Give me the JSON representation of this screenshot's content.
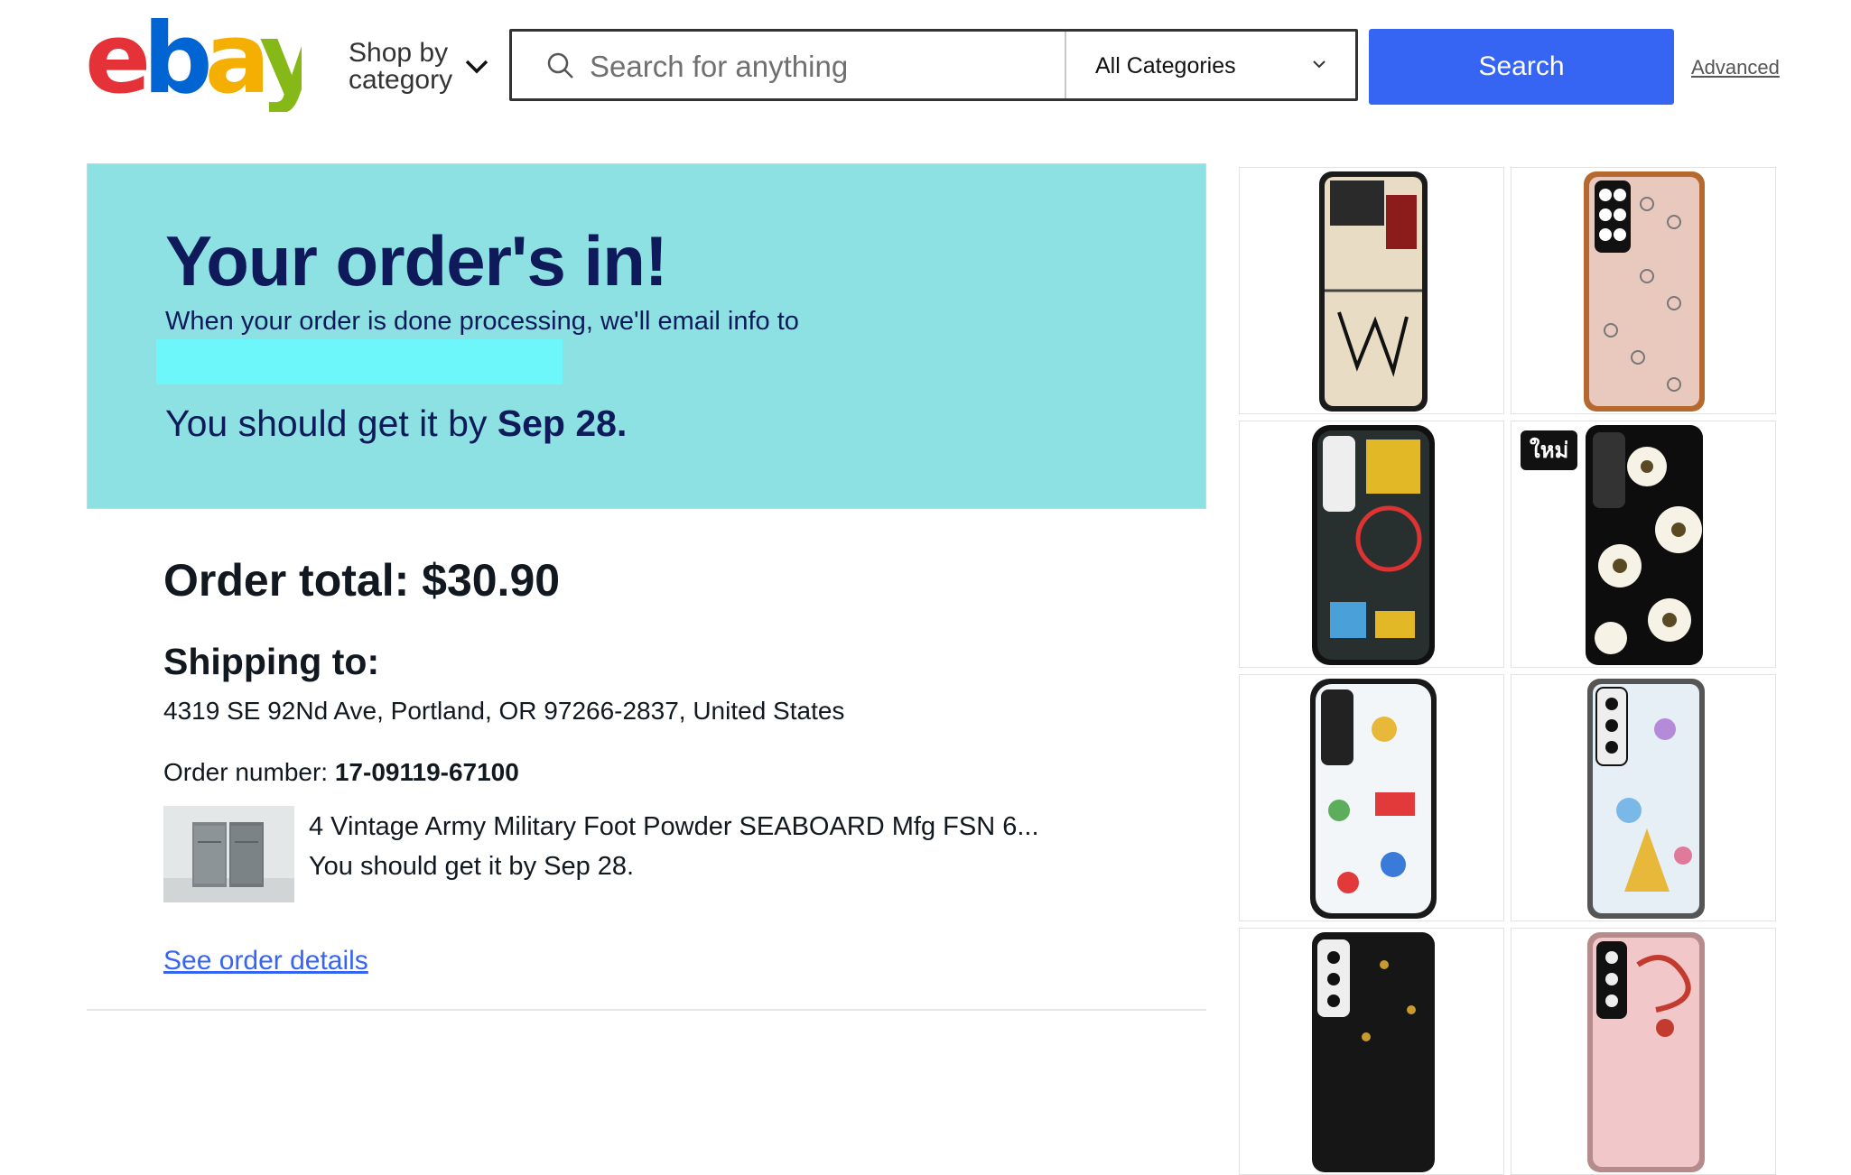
{
  "header": {
    "logo_text": "ebay",
    "logo_colors": [
      "#e53238",
      "#0064d2",
      "#f5af02",
      "#86b817"
    ],
    "shop_by_category_line1": "Shop by",
    "shop_by_category_line2": "category",
    "search_placeholder": "Search for anything",
    "category_select": "All Categories",
    "search_button": "Search",
    "advanced_link": "Advanced"
  },
  "banner": {
    "title": "Your order's in!",
    "email_note": "When your order is done processing, we'll email info to",
    "eta_prefix": "You should get it by ",
    "eta_date": "Sep 28."
  },
  "order": {
    "total_label": "Order total: $30.90",
    "shipping_heading": "Shipping to:",
    "address": "4319 SE 92Nd Ave, Portland, OR 97266-2837, United States",
    "order_number_label": "Order number: ",
    "order_number": "17-09119-67100",
    "item_title": "4 Vintage Army Military Foot Powder SEABOARD Mfg FSN 6...",
    "item_eta": "You should get it by Sep 28.",
    "details_link": "See order details"
  },
  "ads": {
    "new_badge": "ใหม่",
    "items": [
      {
        "name": "basquiat-flip-case",
        "case_color": "#e9dcc4",
        "accent": "#8c1c1c"
      },
      {
        "name": "smiley-pattern-case",
        "case_color": "#e9c9bd",
        "accent": "#b5692f"
      },
      {
        "name": "basquiat-liberty-case",
        "case_color": "#27302f",
        "accent": "#e2b826"
      },
      {
        "name": "daisy-black-case",
        "case_color": "#0d0d0d",
        "accent": "#f6f2e6"
      },
      {
        "name": "toy-story-case",
        "case_color": "#f3f6f8",
        "accent": "#e23a3a"
      },
      {
        "name": "disney-princess-case",
        "case_color": "#e6eef6",
        "accent": "#e7b83a"
      },
      {
        "name": "black-gold-case",
        "case_color": "#161616",
        "accent": "#c89a2f"
      },
      {
        "name": "mulan-pink-case",
        "case_color": "#f2c7c9",
        "accent": "#c23b2e"
      }
    ]
  }
}
